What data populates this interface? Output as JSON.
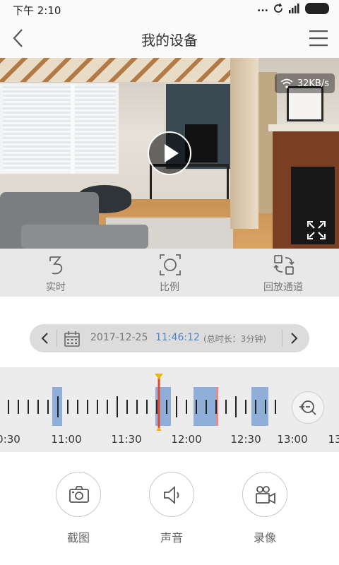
{
  "status_bar": {
    "time": "下午 2:10",
    "signal_text": "...",
    "icons": [
      "sync-icon",
      "signal-icon",
      "battery-icon"
    ]
  },
  "header": {
    "title": "我的设备",
    "back_icon": "chevron-left-icon",
    "menu_icon": "hamburger-menu-icon"
  },
  "video": {
    "speed": "32KB/s",
    "play_icon": "play-icon",
    "fullscreen_icon": "fullscreen-icon",
    "wifi_icon": "wifi-icon"
  },
  "toolbar": {
    "items": [
      {
        "label": "实时",
        "icon": "live-icon"
      },
      {
        "label": "比例",
        "icon": "ratio-icon"
      },
      {
        "label": "回放通道",
        "icon": "playback-channel-icon"
      }
    ]
  },
  "date_bar": {
    "date": "2017-12-25",
    "time": "11:46:12",
    "duration": "(总时长：3分钟)"
  },
  "timeline": {
    "labels": [
      "0:30",
      "11:00",
      "11:30",
      "12:00",
      "12:30",
      "13:00",
      "13"
    ],
    "zoom_icon": "zoom-in-icon",
    "accent_color": "#e8452f",
    "segment_color": "#8fafd8"
  },
  "actions": [
    {
      "label": "截图",
      "icon": "camera-icon"
    },
    {
      "label": "声音",
      "icon": "speaker-icon"
    },
    {
      "label": "录像",
      "icon": "video-camera-icon"
    }
  ]
}
